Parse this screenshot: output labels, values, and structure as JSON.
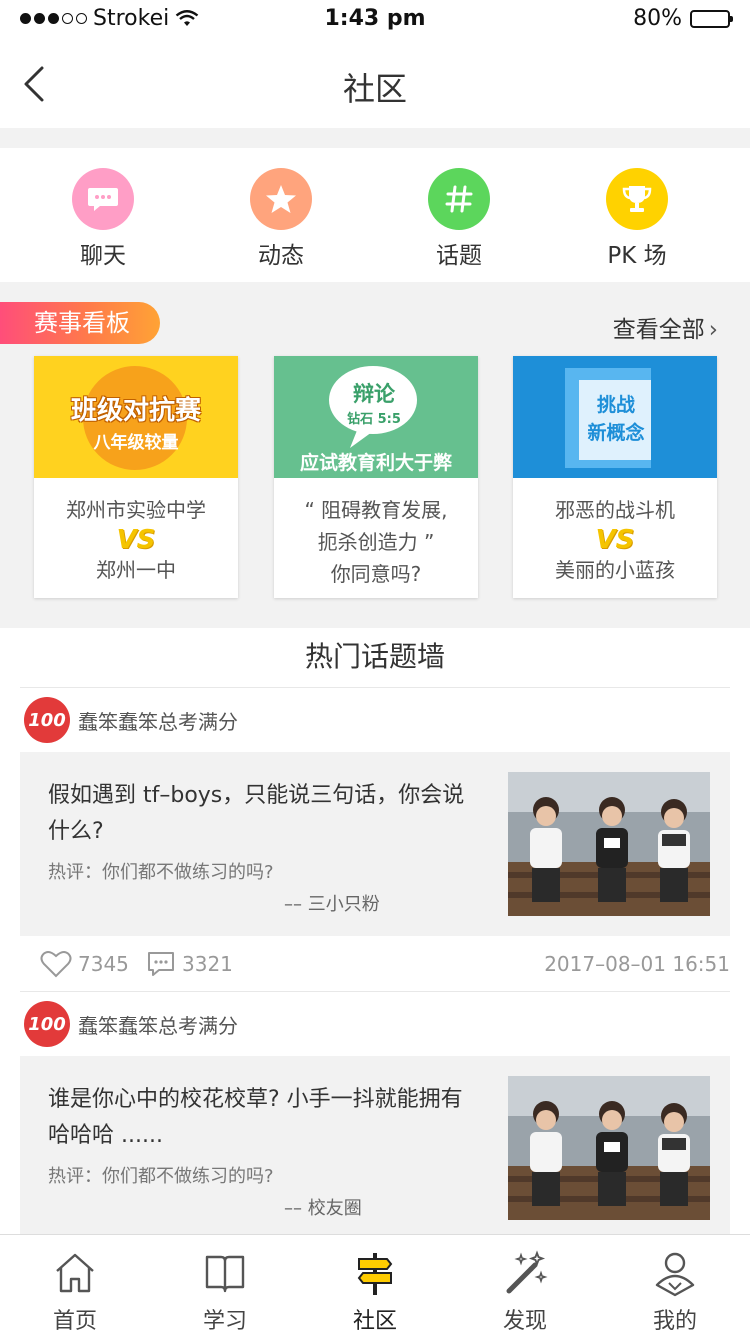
{
  "status_bar": {
    "carrier": "Strokei",
    "time": "1:43 pm",
    "battery": "80%",
    "battery_level": 0.8
  },
  "nav": {
    "title": "社区"
  },
  "categories": [
    {
      "label": "聊天",
      "icon": "chat-bubble-icon",
      "color": "#ff9ec6"
    },
    {
      "label": "动态",
      "icon": "star-icon",
      "color": "#ffa47d"
    },
    {
      "label": "话题",
      "icon": "hashtag-icon",
      "color": "#5cd65c"
    },
    {
      "label": "PK 场",
      "icon": "trophy-icon",
      "color": "#ffd200"
    }
  ],
  "board": {
    "tag": "赛事看板",
    "more": "查看全部",
    "matches": [
      {
        "banner": "班级对抗赛",
        "banner_sub": "八年级较量",
        "top": "郑州市实验中学",
        "vs": "VS",
        "bottom": "郑州一中",
        "color": "#ffd21f"
      },
      {
        "bubble_title": "辩论",
        "bubble_sub": "钻石 5:5",
        "banner": "应试教育利大于弊",
        "line1": "“ 阻碍教育发展,",
        "line2": "扼杀创造力 ”",
        "line3": "你同意吗?",
        "color": "#66c08f"
      },
      {
        "banner": "挑战",
        "banner_sub": "新概念",
        "top": "邪恶的战斗机",
        "vs": "VS",
        "bottom": "美丽的小蓝孩",
        "color": "#1e8fd8"
      }
    ]
  },
  "hot": {
    "title": "热门话题墙",
    "posts": [
      {
        "avatar": "100",
        "author": "蠢笨蠢笨总考满分",
        "text": "假如遇到 tf–boys，只能说三句话，你会说什么?",
        "hot_comment": "热评：你们都不做练习的吗?",
        "by": "–– 三小只粉",
        "likes": "7345",
        "comments": "3321",
        "time": "2017–08–01   16:51"
      },
      {
        "avatar": "100",
        "author": "蠢笨蠢笨总考满分",
        "text": "谁是你心中的校花校草? 小手一抖就能拥有哈哈哈 ......",
        "hot_comment": "热评：你们都不做练习的吗?",
        "by": "–– 校友圈"
      }
    ]
  },
  "tabs": [
    {
      "label": "首页",
      "icon": "home-icon"
    },
    {
      "label": "学习",
      "icon": "book-icon"
    },
    {
      "label": "社区",
      "icon": "signpost-icon",
      "active": true
    },
    {
      "label": "发现",
      "icon": "magic-wand-icon"
    },
    {
      "label": "我的",
      "icon": "profile-icon"
    }
  ]
}
